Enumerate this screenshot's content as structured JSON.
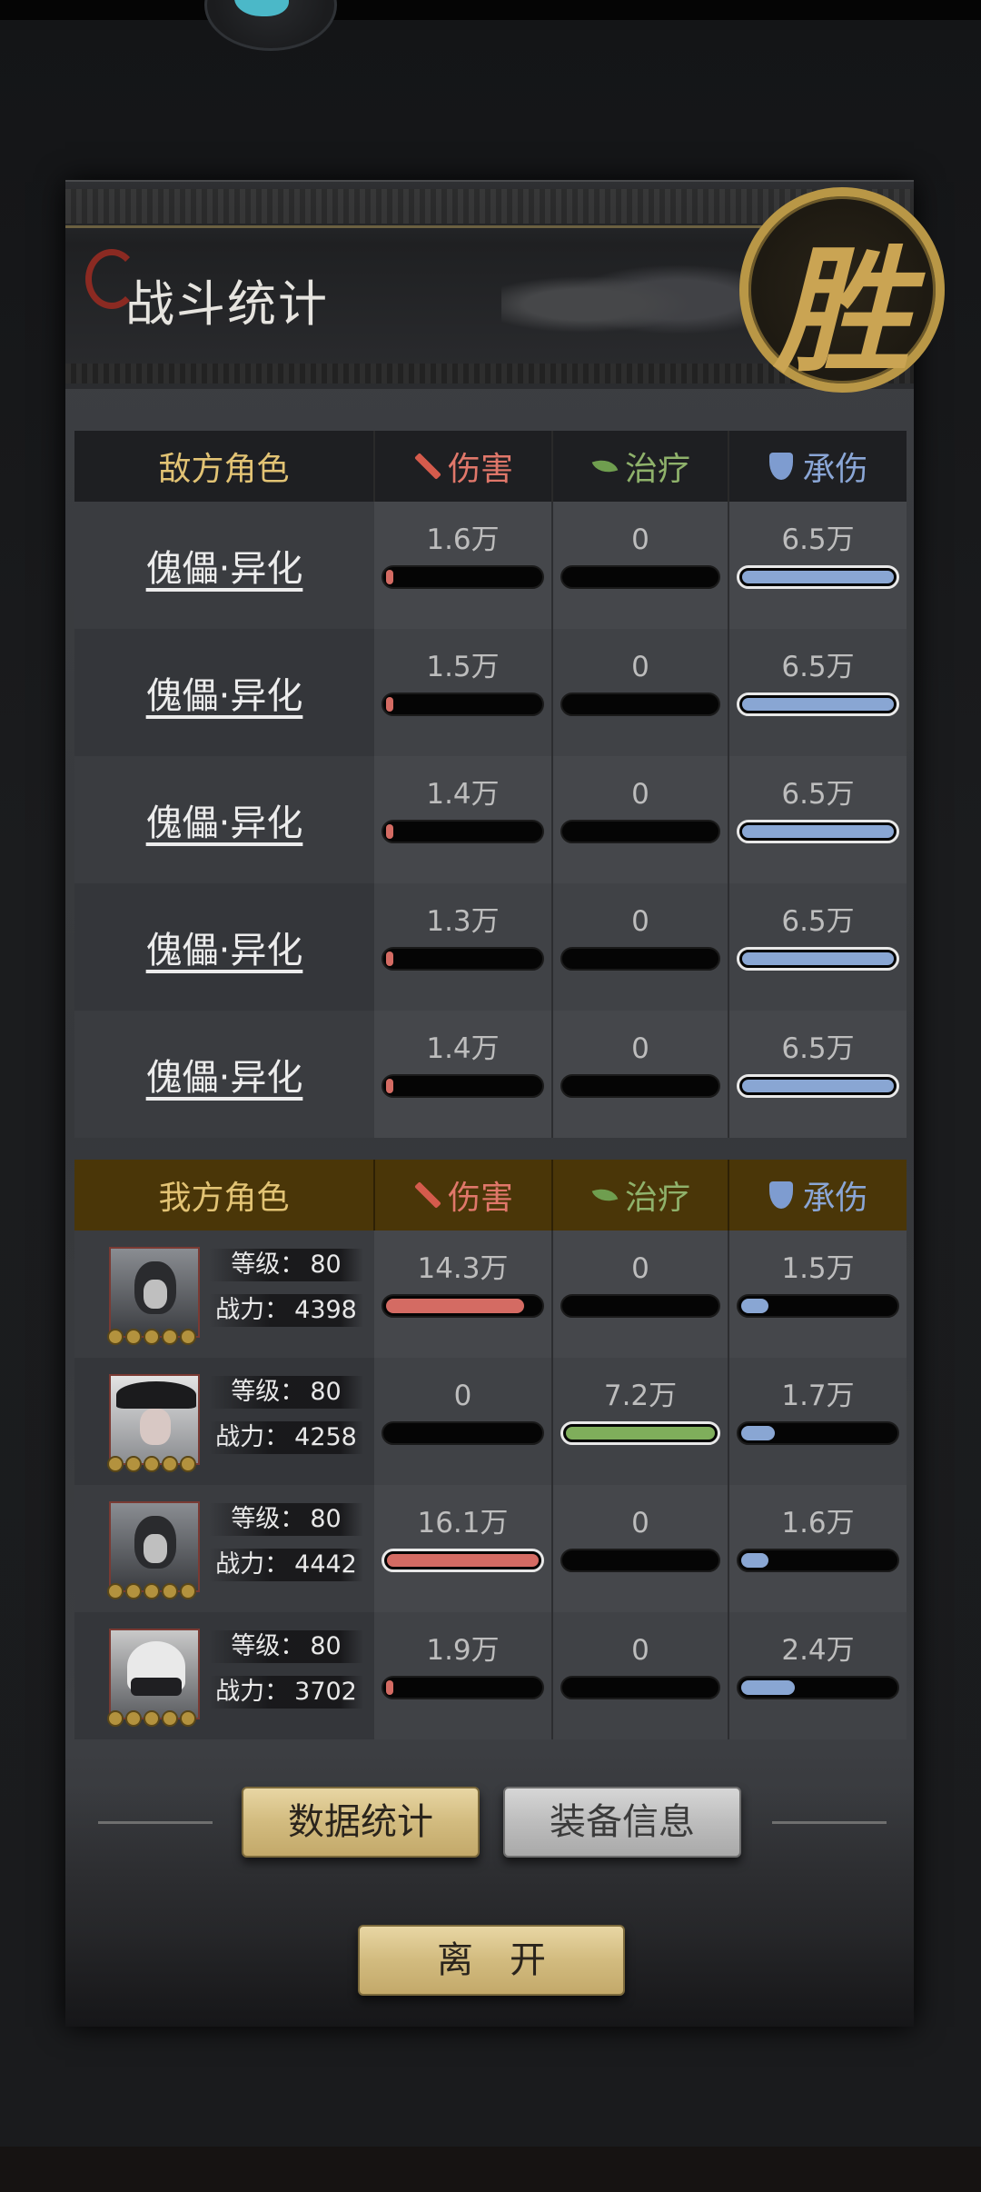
{
  "header": {
    "title": "战斗统计",
    "seal": "胜"
  },
  "columns": {
    "damage": "伤害",
    "heal": "治疗",
    "tank": "承伤"
  },
  "enemy": {
    "role_header": "敌方角色",
    "rows": [
      {
        "name": "傀儡·异化",
        "damage": "1.6万",
        "heal": "0",
        "tank": "6.5万",
        "damage_pct": 3,
        "heal_pct": 0,
        "tank_pct": 100
      },
      {
        "name": "傀儡·异化",
        "damage": "1.5万",
        "heal": "0",
        "tank": "6.5万",
        "damage_pct": 3,
        "heal_pct": 0,
        "tank_pct": 100
      },
      {
        "name": "傀儡·异化",
        "damage": "1.4万",
        "heal": "0",
        "tank": "6.5万",
        "damage_pct": 3,
        "heal_pct": 0,
        "tank_pct": 100
      },
      {
        "name": "傀儡·异化",
        "damage": "1.3万",
        "heal": "0",
        "tank": "6.5万",
        "damage_pct": 3,
        "heal_pct": 0,
        "tank_pct": 100
      },
      {
        "name": "傀儡·异化",
        "damage": "1.4万",
        "heal": "0",
        "tank": "6.5万",
        "damage_pct": 3,
        "heal_pct": 0,
        "tank_pct": 100
      }
    ]
  },
  "ally": {
    "role_header": "我方角色",
    "level_label": "等级：",
    "power_label": "战力：",
    "rows": [
      {
        "level": "80",
        "power": "4398",
        "damage": "14.3万",
        "heal": "0",
        "tank": "1.5万",
        "damage_pct": 90,
        "heal_pct": 0,
        "tank_pct": 18
      },
      {
        "level": "80",
        "power": "4258",
        "damage": "0",
        "heal": "7.2万",
        "tank": "1.7万",
        "damage_pct": 0,
        "heal_pct": 100,
        "tank_pct": 22
      },
      {
        "level": "80",
        "power": "4442",
        "damage": "16.1万",
        "heal": "0",
        "tank": "1.6万",
        "damage_pct": 100,
        "heal_pct": 0,
        "tank_pct": 18
      },
      {
        "level": "80",
        "power": "3702",
        "damage": "1.9万",
        "heal": "0",
        "tank": "2.4万",
        "damage_pct": 5,
        "heal_pct": 0,
        "tank_pct": 35
      }
    ]
  },
  "buttons": {
    "data_stats": "数据统计",
    "equipment": "装备信息",
    "leave": "离　开"
  },
  "colors": {
    "damage": "#d46b63",
    "heal": "#7fae5b",
    "tank": "#89a6d3",
    "gold": "#caa453"
  }
}
